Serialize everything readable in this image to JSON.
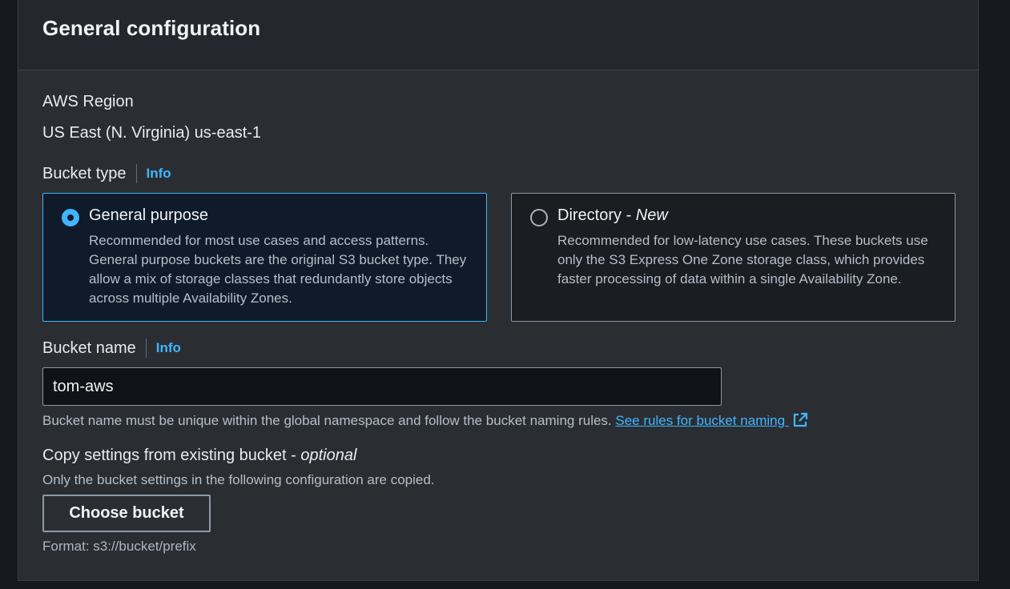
{
  "panel": {
    "title": "General configuration"
  },
  "region": {
    "label": "AWS Region",
    "value": "US East (N. Virginia) us-east-1"
  },
  "bucket_type": {
    "label": "Bucket type",
    "info": "Info",
    "options": [
      {
        "title": "General purpose",
        "title_suffix": "",
        "selected": true,
        "description": "Recommended for most use cases and access patterns. General purpose buckets are the original S3 bucket type. They allow a mix of storage classes that redundantly store objects across multiple Availability Zones."
      },
      {
        "title": "Directory - ",
        "title_suffix": "New",
        "selected": false,
        "description": "Recommended for low-latency use cases. These buckets use only the S3 Express One Zone storage class, which provides faster processing of data within a single Availability Zone."
      }
    ]
  },
  "bucket_name": {
    "label": "Bucket name",
    "info": "Info",
    "value": "tom-aws",
    "hint": "Bucket name must be unique within the global namespace and follow the bucket naming rules.",
    "link": "See rules for bucket naming"
  },
  "copy_settings": {
    "label": "Copy settings from existing bucket - ",
    "label_suffix": "optional",
    "description": "Only the bucket settings in the following configuration are copied.",
    "button": "Choose bucket",
    "format_hint": "Format: s3://bucket/prefix"
  },
  "colors": {
    "accent": "#42b4ff",
    "panel_bg": "#2a2e33",
    "header_bg": "#24272d"
  }
}
